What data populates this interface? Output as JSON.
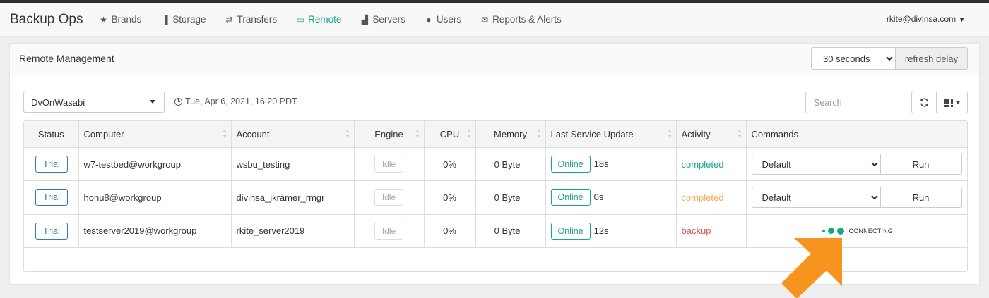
{
  "app": {
    "brand": "Backup Ops",
    "user": "rkite@divinsa.com"
  },
  "nav": [
    {
      "label": "Brands",
      "icon": "star-icon",
      "glyph": "★"
    },
    {
      "label": "Storage",
      "icon": "bar-chart-icon",
      "glyph": "▐"
    },
    {
      "label": "Transfers",
      "icon": "transfer-icon",
      "glyph": "⇄"
    },
    {
      "label": "Remote",
      "icon": "monitor-icon",
      "glyph": "▭"
    },
    {
      "label": "Servers",
      "icon": "signal-icon",
      "glyph": "▟"
    },
    {
      "label": "Users",
      "icon": "users-icon",
      "glyph": "●"
    },
    {
      "label": "Reports & Alerts",
      "icon": "envelope-icon",
      "glyph": "✉"
    }
  ],
  "panel": {
    "title": "Remote Management",
    "refresh_value": "30 seconds",
    "refresh_addon": "refresh delay"
  },
  "toolbar": {
    "selected_brand": "DvOnWasabi",
    "timestamp": "Tue, Apr 6, 2021, 16:20 PDT",
    "search_placeholder": "Search"
  },
  "table": {
    "headers": [
      "Status",
      "Computer",
      "Account",
      "Engine",
      "CPU",
      "Memory",
      "Last Service Update",
      "Activity",
      "Commands"
    ],
    "rows": [
      {
        "status": "Trial",
        "computer": "w7-testbed@workgroup",
        "account": "wsbu_testing",
        "engine": "Idle",
        "cpu": "0%",
        "memory": "0 Byte",
        "service": "Online",
        "service_age": "18s",
        "activity": "completed",
        "command": "Default",
        "run": "Run"
      },
      {
        "status": "Trial",
        "computer": "honu8@workgroup",
        "account": "divinsa_jkramer_rmgr",
        "engine": "Idle",
        "cpu": "0%",
        "memory": "0 Byte",
        "service": "Online",
        "service_age": "0s",
        "activity": "completed",
        "command": "Default",
        "run": "Run"
      },
      {
        "status": "Trial",
        "computer": "testserver2019@workgroup",
        "account": "rkite_server2019",
        "engine": "Idle",
        "cpu": "0%",
        "memory": "0 Byte",
        "service": "Online",
        "service_age": "12s",
        "activity": "backup",
        "connecting": "CONNECTING"
      }
    ]
  },
  "colors": {
    "accent": "#18a689",
    "primary": "#337ab7",
    "warning": "#f0ad4e",
    "danger": "#d9534f",
    "arrow": "#f7941d"
  }
}
